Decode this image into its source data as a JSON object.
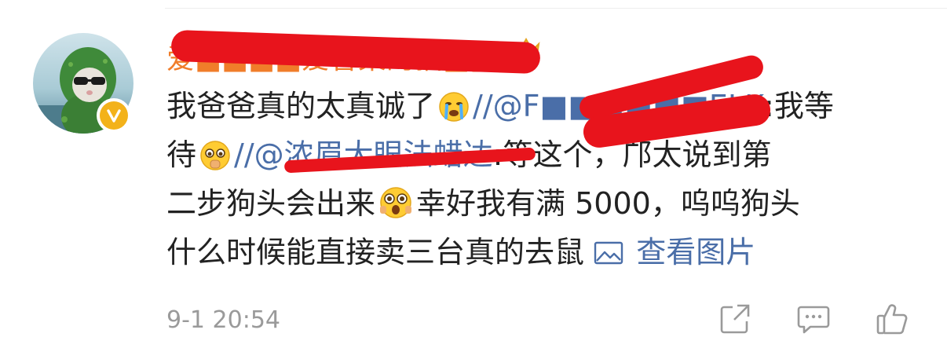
{
  "post": {
    "username": "爱■■■■爱香菜的猫■■",
    "lines": {
      "l1_text": "我爸爸真的太真诚了",
      "l1_sep": "//",
      "l1_mention": "@F■■■■■■ELK",
      "l1_after": ":我等",
      "l2_text": "待",
      "l2_sep": "//",
      "l2_mention": "@浓眉大眼法蜡达",
      "l2_after": ":等这个，邝太说到第",
      "l3_text": "二步狗头会出来",
      "l3_after": "幸好我有满 5000，呜呜狗头",
      "l4_text": "什么时候能直接卖三台真的去鼠",
      "view_image": "查看图片"
    },
    "timestamp": "9-1 20:54"
  },
  "icons": {
    "verified": "verified-badge-icon",
    "vip": "crown-icon",
    "share": "share-icon",
    "comment": "comment-icon",
    "like": "like-icon",
    "image": "image-icon"
  },
  "colors": {
    "username": "#f07d2a",
    "mention": "#4a6ea8",
    "text": "#222222",
    "timestamp": "#9a9a9a",
    "verified": "#f3b21a",
    "redaction": "#e8141c"
  }
}
